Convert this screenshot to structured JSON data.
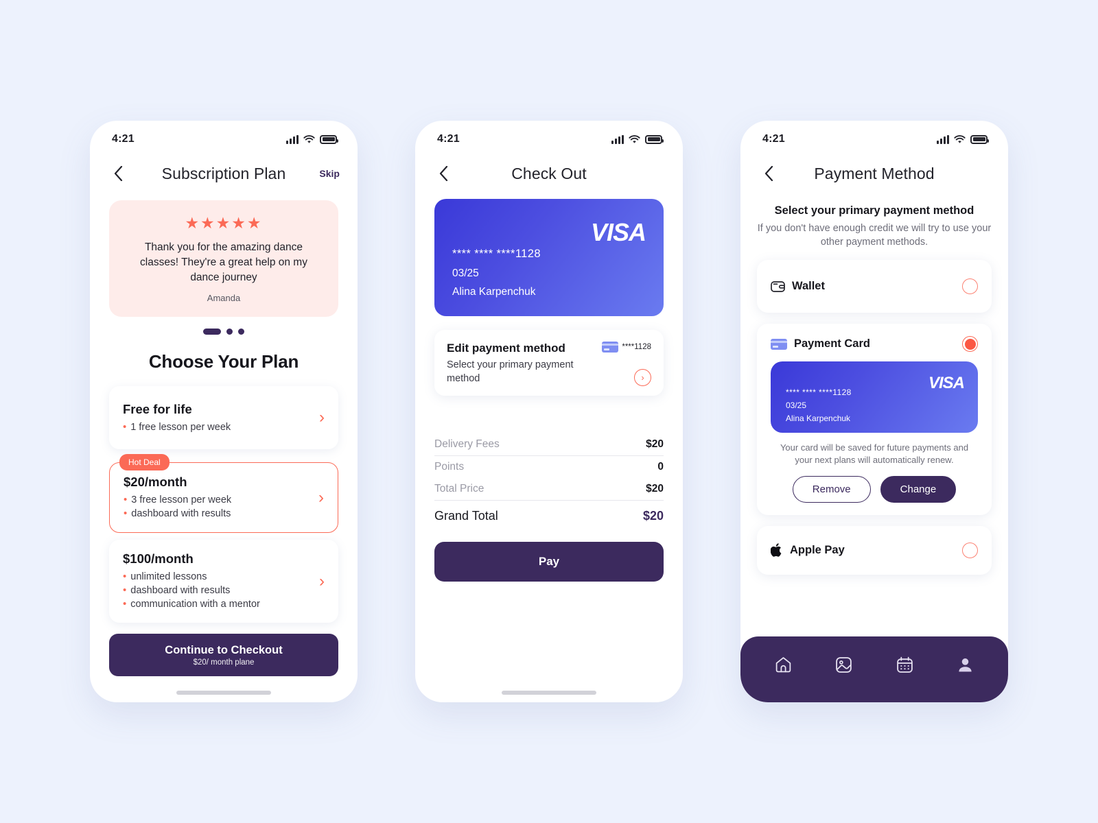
{
  "meta": {
    "bg_color": "#EDF2FD",
    "accent_coral": "#FB6A56",
    "accent_purple": "#3C2A5E",
    "card_blue": "#4C4EE0"
  },
  "status_bar": {
    "time": "4:21",
    "signal_icon": "signal-bars-icon",
    "wifi_icon": "wifi-icon",
    "battery_icon": "battery-icon"
  },
  "screen1": {
    "title": "Subscription Plan",
    "back_icon": "chevron-left-icon",
    "skip_label": "Skip",
    "testimonial": {
      "stars": "★★★★★",
      "rating": 5,
      "text": "Thank you for the amazing dance classes! They're a great help on my dance journey",
      "author": "Amanda"
    },
    "carousel": {
      "total": 3,
      "active_index": 0
    },
    "section_title": "Choose Your Plan",
    "plans": [
      {
        "name": "Free for life",
        "features": [
          "1 free lesson per week"
        ],
        "badge": null,
        "highlighted": false,
        "chevron_icon": "chevron-right-icon"
      },
      {
        "name": "$20/month",
        "features": [
          "3 free lesson per week",
          "dashboard with results"
        ],
        "badge": "Hot Deal",
        "highlighted": true,
        "chevron_icon": "chevron-right-icon"
      },
      {
        "name": "$100/month",
        "features": [
          "unlimited lessons",
          "dashboard with results",
          "communication with a mentor"
        ],
        "badge": null,
        "highlighted": false,
        "chevron_icon": "chevron-right-icon"
      }
    ],
    "cta": {
      "main": "Continue to Checkout",
      "sub": "$20/ month plane"
    }
  },
  "screen2": {
    "title": "Check Out",
    "back_icon": "chevron-left-icon",
    "card": {
      "brand": "VISA",
      "number": "**** **** ****1128",
      "expiry": "03/25",
      "holder": "Alina Karpenchuk"
    },
    "edit_payment": {
      "title": "Edit payment method",
      "subtitle": "Select your primary payment method",
      "card_icon": "credit-card-icon",
      "card_digits": "****1128",
      "arrow_icon": "circle-chevron-right-icon"
    },
    "summary": [
      {
        "label": "Delivery Fees",
        "value": "$20"
      },
      {
        "label": "Points",
        "value": "0"
      },
      {
        "label": "Total Price",
        "value": "$20"
      }
    ],
    "grand_total": {
      "label": "Grand Total",
      "value": "$20"
    },
    "pay_label": "Pay"
  },
  "screen3": {
    "title": "Payment Method",
    "back_icon": "chevron-left-icon",
    "heading": "Select your primary payment method",
    "subheading": "If you don't have enough credit we will try to use your other payment methods.",
    "methods": [
      {
        "label": "Wallet",
        "icon": "wallet-icon",
        "selected": false
      },
      {
        "label": "Payment Card",
        "icon": "credit-card-icon",
        "selected": true
      },
      {
        "label": "Apple Pay",
        "icon": "apple-icon",
        "selected": false
      }
    ],
    "card": {
      "brand": "VISA",
      "number": "**** **** ****1128",
      "expiry": "03/25",
      "holder": "Alina Karpenchuk"
    },
    "note": "Your card will be saved for future payments and your next plans will automatically renew.",
    "remove_label": "Remove",
    "change_label": "Change",
    "tabs": [
      {
        "icon": "home-icon",
        "active": false
      },
      {
        "icon": "gallery-icon",
        "active": false
      },
      {
        "icon": "calendar-icon",
        "active": false
      },
      {
        "icon": "profile-icon",
        "active": true
      }
    ]
  }
}
